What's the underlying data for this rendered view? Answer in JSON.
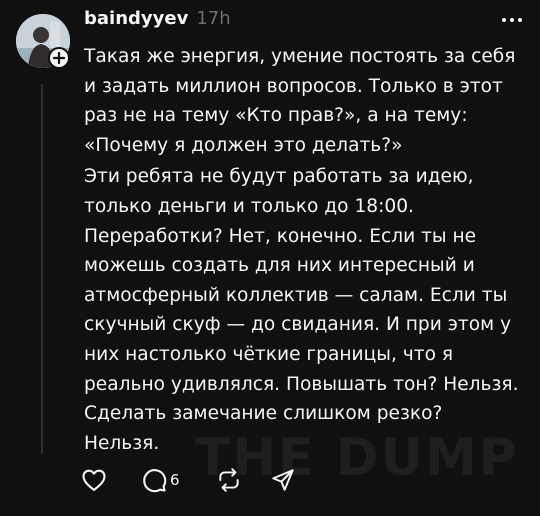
{
  "post": {
    "username": "baindyyev",
    "time": "17h",
    "paragraphs": [
      {
        "lines": [
          "Такая же энергия, умение постоять за себя",
          "и задать миллион вопросов. Только в этот",
          "раз не на тему «Кто прав?», а на тему:",
          "«Почему я должен это делать?»"
        ]
      },
      {
        "lines": [
          "Эти ребята не будут работать за идею,",
          "только деньги и только до 18:00.",
          "Переработки? Нет, конечно. Если ты не",
          "можешь создать для них интересный и",
          "атмосферный коллектив — салам. Если ты",
          "скучный скуф — до свидания. И при этом у",
          "них настолько чёткие границы, что я",
          "реально удивлялся. Повышать тон? Нельзя.",
          "Сделать замечание слишком резко?",
          "Нельзя."
        ]
      }
    ],
    "reply_count": "6",
    "watermark": "THE DUMP"
  },
  "icons": {
    "avatar": "avatar-photo",
    "follow": "plus-icon",
    "more": "more-dots-icon",
    "like": "heart-icon",
    "reply": "comment-bubble-icon",
    "repost": "repost-icon",
    "share": "send-icon"
  },
  "colors": {
    "background": "#101010",
    "text": "#f3f5f7",
    "muted": "#6e6e6e",
    "watermark": "#1e1e1e"
  }
}
